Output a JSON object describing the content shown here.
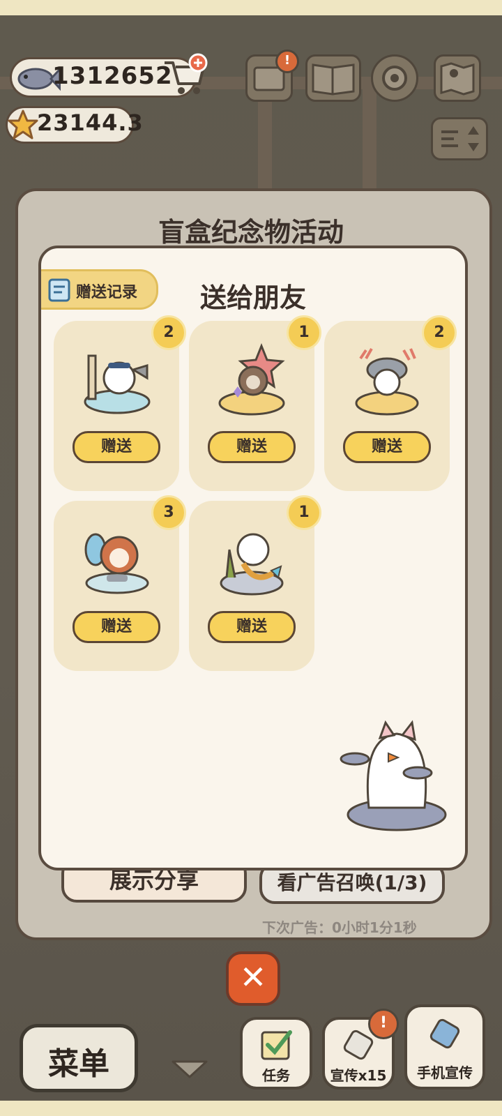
{
  "hud": {
    "fish_count": "1312652",
    "star_count": "23144.3"
  },
  "modal": {
    "title": "盲盒纪念物活动",
    "inner_title": "送给朋友",
    "record_label": "赠送记录",
    "items": [
      {
        "count": "2",
        "button": "赠送"
      },
      {
        "count": "1",
        "button": "赠送"
      },
      {
        "count": "2",
        "button": "赠送"
      },
      {
        "count": "3",
        "button": "赠送"
      },
      {
        "count": "1",
        "button": "赠送"
      }
    ],
    "share_label": "展示分享",
    "ad_label": "看广告召唤(1/3)",
    "next_ad": "下次广告：0小时1分1秒"
  },
  "close_symbol": "✕",
  "bottom_bar": {
    "menu_label": "菜单",
    "tasks_label": "任务",
    "promote_label": "宣传x15",
    "phone_promo_label": "手机宣传"
  },
  "colors": {
    "accent_yellow": "#f7d25c",
    "close_red": "#e05c2c",
    "badge_yellow": "#f4cc55"
  }
}
